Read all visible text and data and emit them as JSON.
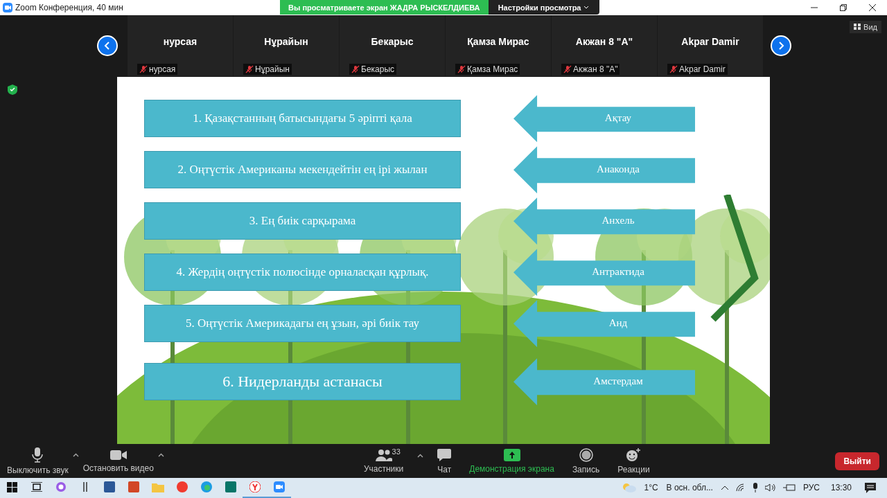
{
  "window": {
    "title": "Zoom Конференция, 40 мин"
  },
  "share_banner": {
    "text": "Вы просматриваете экран ЖАДРА РЫСКЕЛДИЕВА",
    "options": "Настройки просмотра"
  },
  "view_button": "Вид",
  "participants": [
    {
      "name": "нурсая",
      "label": "нурсая",
      "muted": true
    },
    {
      "name": "Нұрайын",
      "label": "Нұрайын",
      "muted": true
    },
    {
      "name": "Бекарыс",
      "label": "Бекарыс",
      "muted": true
    },
    {
      "name": "Қамза Мирас",
      "label": "Қамза Мирас",
      "muted": true
    },
    {
      "name": "Акжан 8 \"А\"",
      "label": "Акжан 8 \"А\"",
      "muted": true
    },
    {
      "name": "Akpar Damir",
      "label": "Akpar Damir",
      "muted": true
    }
  ],
  "slide": {
    "rows": [
      {
        "question": "1. Қазақстанның батысындағы 5 әріпті қала",
        "answer": "Ақтау",
        "large": false
      },
      {
        "question": "2. Оңтүстік Американы мекендейтін ең ірі жылан",
        "answer": "Анаконда",
        "large": false
      },
      {
        "question": "3. Ең биік сарқырама",
        "answer": "Анхель",
        "large": false
      },
      {
        "question": "4. Жердің оңтүстік полюсінде орналасқан құрлық.",
        "answer": "Антрактида",
        "large": false
      },
      {
        "question": "5. Оңтүстік Америкадағы ең ұзын, әрі биік тау",
        "answer": "Анд",
        "large": false
      },
      {
        "question": "6. Нидерланды астанасы",
        "answer": "Амстердам",
        "large": true
      }
    ]
  },
  "toolbar": {
    "left": [
      {
        "kind": "mic",
        "label": "Выключить звук",
        "active": false
      },
      {
        "kind": "video",
        "label": "Остановить видео",
        "active": false
      }
    ],
    "center": [
      {
        "kind": "participants",
        "label": "Участники",
        "count": "33",
        "active": false
      },
      {
        "kind": "chat",
        "label": "Чат",
        "active": false
      },
      {
        "kind": "share",
        "label": "Демонстрация экрана",
        "active": true
      },
      {
        "kind": "record",
        "label": "Запись",
        "active": false
      },
      {
        "kind": "reactions",
        "label": "Реакции",
        "active": false
      }
    ],
    "leave": "Выйти"
  },
  "taskbar": {
    "apps": [
      {
        "kind": "start",
        "open": false
      },
      {
        "kind": "taskview",
        "open": false
      },
      {
        "kind": "alice",
        "open": false
      },
      {
        "kind": "bars",
        "open": false
      },
      {
        "kind": "word",
        "open": false
      },
      {
        "kind": "powerpoint",
        "open": false
      },
      {
        "kind": "explorer",
        "open": false
      },
      {
        "kind": "yandex",
        "open": false
      },
      {
        "kind": "edge",
        "open": false
      },
      {
        "kind": "publisher",
        "open": false
      },
      {
        "kind": "ybrowser",
        "open": true
      },
      {
        "kind": "zoom",
        "open": true
      }
    ],
    "temperature": "1°C",
    "weather": "В осн. обл...",
    "language": "РУС",
    "time": "13:30"
  }
}
